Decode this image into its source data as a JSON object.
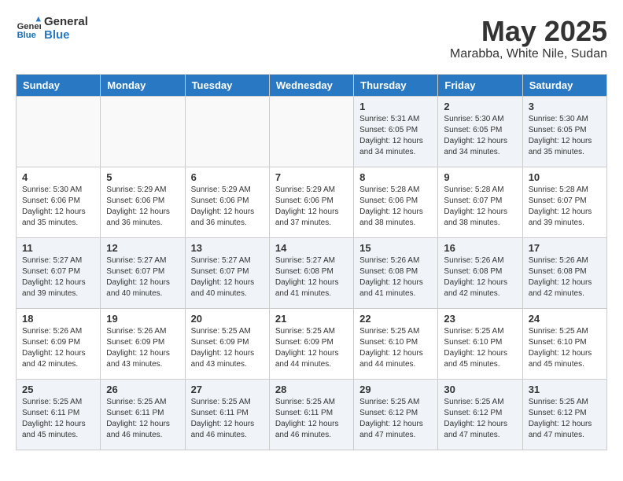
{
  "logo": {
    "line1": "General",
    "line2": "Blue"
  },
  "title": "May 2025",
  "subtitle": "Marabba, White Nile, Sudan",
  "days_header": [
    "Sunday",
    "Monday",
    "Tuesday",
    "Wednesday",
    "Thursday",
    "Friday",
    "Saturday"
  ],
  "weeks": [
    [
      {
        "day": "",
        "content": ""
      },
      {
        "day": "",
        "content": ""
      },
      {
        "day": "",
        "content": ""
      },
      {
        "day": "",
        "content": ""
      },
      {
        "day": "1",
        "content": "Sunrise: 5:31 AM\nSunset: 6:05 PM\nDaylight: 12 hours\nand 34 minutes."
      },
      {
        "day": "2",
        "content": "Sunrise: 5:30 AM\nSunset: 6:05 PM\nDaylight: 12 hours\nand 34 minutes."
      },
      {
        "day": "3",
        "content": "Sunrise: 5:30 AM\nSunset: 6:05 PM\nDaylight: 12 hours\nand 35 minutes."
      }
    ],
    [
      {
        "day": "4",
        "content": "Sunrise: 5:30 AM\nSunset: 6:06 PM\nDaylight: 12 hours\nand 35 minutes."
      },
      {
        "day": "5",
        "content": "Sunrise: 5:29 AM\nSunset: 6:06 PM\nDaylight: 12 hours\nand 36 minutes."
      },
      {
        "day": "6",
        "content": "Sunrise: 5:29 AM\nSunset: 6:06 PM\nDaylight: 12 hours\nand 36 minutes."
      },
      {
        "day": "7",
        "content": "Sunrise: 5:29 AM\nSunset: 6:06 PM\nDaylight: 12 hours\nand 37 minutes."
      },
      {
        "day": "8",
        "content": "Sunrise: 5:28 AM\nSunset: 6:06 PM\nDaylight: 12 hours\nand 38 minutes."
      },
      {
        "day": "9",
        "content": "Sunrise: 5:28 AM\nSunset: 6:07 PM\nDaylight: 12 hours\nand 38 minutes."
      },
      {
        "day": "10",
        "content": "Sunrise: 5:28 AM\nSunset: 6:07 PM\nDaylight: 12 hours\nand 39 minutes."
      }
    ],
    [
      {
        "day": "11",
        "content": "Sunrise: 5:27 AM\nSunset: 6:07 PM\nDaylight: 12 hours\nand 39 minutes."
      },
      {
        "day": "12",
        "content": "Sunrise: 5:27 AM\nSunset: 6:07 PM\nDaylight: 12 hours\nand 40 minutes."
      },
      {
        "day": "13",
        "content": "Sunrise: 5:27 AM\nSunset: 6:07 PM\nDaylight: 12 hours\nand 40 minutes."
      },
      {
        "day": "14",
        "content": "Sunrise: 5:27 AM\nSunset: 6:08 PM\nDaylight: 12 hours\nand 41 minutes."
      },
      {
        "day": "15",
        "content": "Sunrise: 5:26 AM\nSunset: 6:08 PM\nDaylight: 12 hours\nand 41 minutes."
      },
      {
        "day": "16",
        "content": "Sunrise: 5:26 AM\nSunset: 6:08 PM\nDaylight: 12 hours\nand 42 minutes."
      },
      {
        "day": "17",
        "content": "Sunrise: 5:26 AM\nSunset: 6:08 PM\nDaylight: 12 hours\nand 42 minutes."
      }
    ],
    [
      {
        "day": "18",
        "content": "Sunrise: 5:26 AM\nSunset: 6:09 PM\nDaylight: 12 hours\nand 42 minutes."
      },
      {
        "day": "19",
        "content": "Sunrise: 5:26 AM\nSunset: 6:09 PM\nDaylight: 12 hours\nand 43 minutes."
      },
      {
        "day": "20",
        "content": "Sunrise: 5:25 AM\nSunset: 6:09 PM\nDaylight: 12 hours\nand 43 minutes."
      },
      {
        "day": "21",
        "content": "Sunrise: 5:25 AM\nSunset: 6:09 PM\nDaylight: 12 hours\nand 44 minutes."
      },
      {
        "day": "22",
        "content": "Sunrise: 5:25 AM\nSunset: 6:10 PM\nDaylight: 12 hours\nand 44 minutes."
      },
      {
        "day": "23",
        "content": "Sunrise: 5:25 AM\nSunset: 6:10 PM\nDaylight: 12 hours\nand 45 minutes."
      },
      {
        "day": "24",
        "content": "Sunrise: 5:25 AM\nSunset: 6:10 PM\nDaylight: 12 hours\nand 45 minutes."
      }
    ],
    [
      {
        "day": "25",
        "content": "Sunrise: 5:25 AM\nSunset: 6:11 PM\nDaylight: 12 hours\nand 45 minutes."
      },
      {
        "day": "26",
        "content": "Sunrise: 5:25 AM\nSunset: 6:11 PM\nDaylight: 12 hours\nand 46 minutes."
      },
      {
        "day": "27",
        "content": "Sunrise: 5:25 AM\nSunset: 6:11 PM\nDaylight: 12 hours\nand 46 minutes."
      },
      {
        "day": "28",
        "content": "Sunrise: 5:25 AM\nSunset: 6:11 PM\nDaylight: 12 hours\nand 46 minutes."
      },
      {
        "day": "29",
        "content": "Sunrise: 5:25 AM\nSunset: 6:12 PM\nDaylight: 12 hours\nand 47 minutes."
      },
      {
        "day": "30",
        "content": "Sunrise: 5:25 AM\nSunset: 6:12 PM\nDaylight: 12 hours\nand 47 minutes."
      },
      {
        "day": "31",
        "content": "Sunrise: 5:25 AM\nSunset: 6:12 PM\nDaylight: 12 hours\nand 47 minutes."
      }
    ]
  ]
}
